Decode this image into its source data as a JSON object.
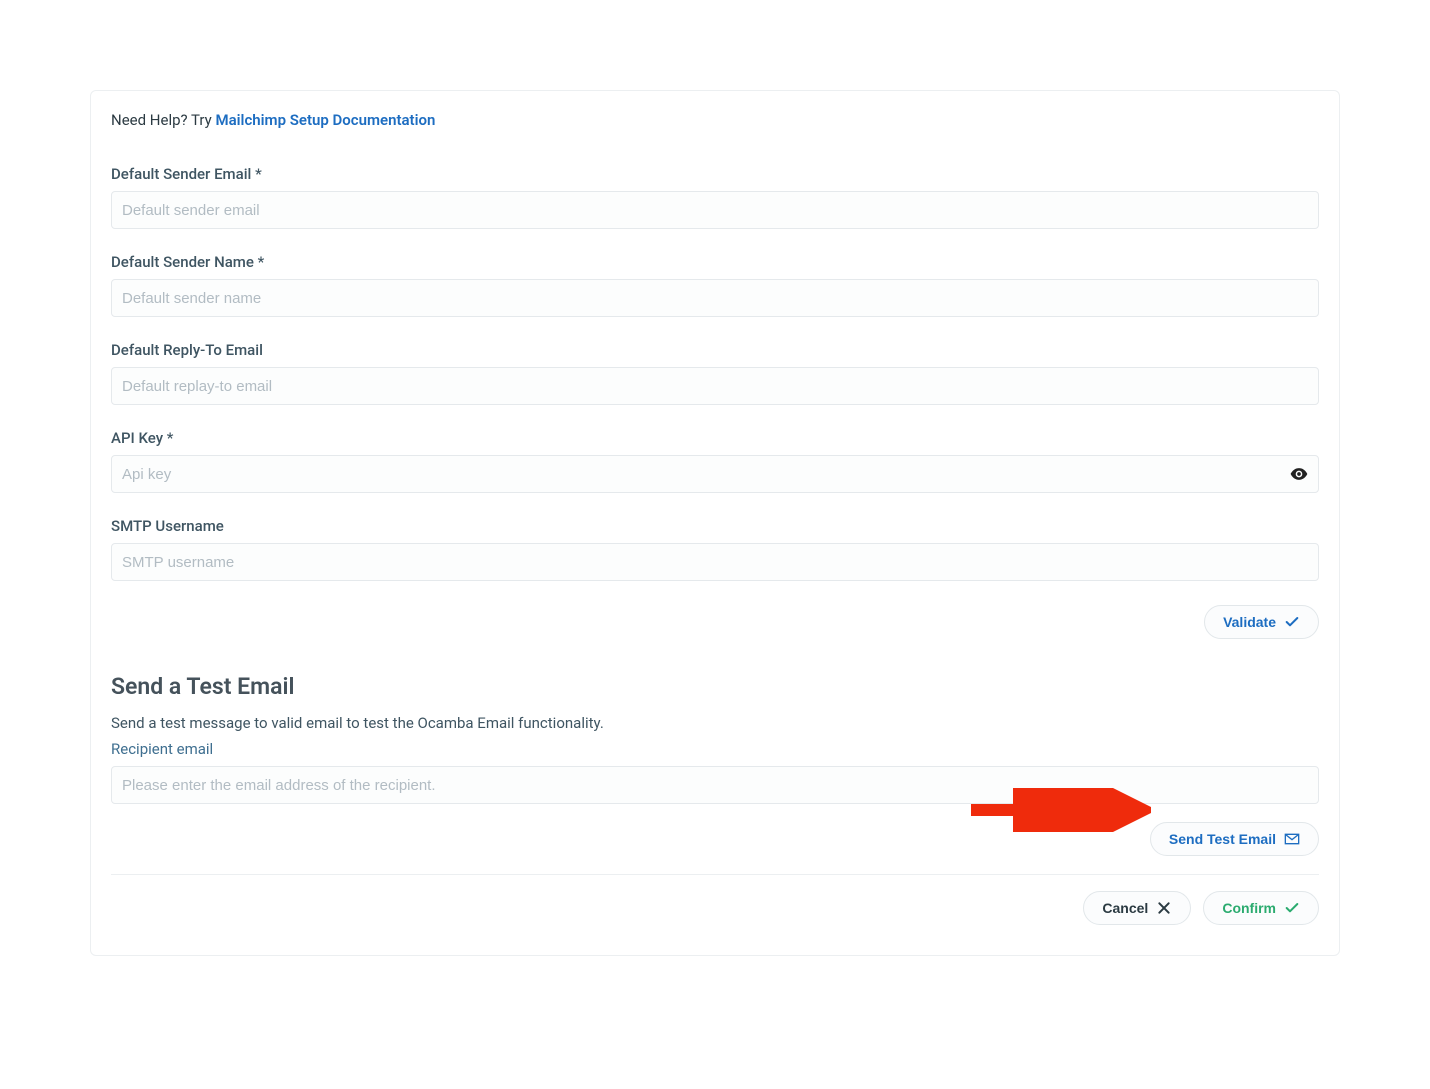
{
  "help": {
    "prefix": "Need Help? Try ",
    "link_text": "Mailchimp Setup Documentation"
  },
  "fields": {
    "sender_email": {
      "label": "Default Sender Email *",
      "placeholder": "Default sender email"
    },
    "sender_name": {
      "label": "Default Sender Name *",
      "placeholder": "Default sender name"
    },
    "reply_to": {
      "label": "Default Reply-To Email",
      "placeholder": "Default replay-to email"
    },
    "api_key": {
      "label": "API Key *",
      "placeholder": "Api key"
    },
    "smtp_user": {
      "label": "SMTP Username",
      "placeholder": "SMTP username"
    }
  },
  "buttons": {
    "validate": "Validate",
    "send_test": "Send Test Email",
    "cancel": "Cancel",
    "confirm": "Confirm"
  },
  "test_section": {
    "title": "Send a Test Email",
    "desc": "Send a test message to valid email to test the Ocamba Email functionality.",
    "recipient_label": "Recipient email",
    "recipient_placeholder": "Please enter the email address of the recipient."
  }
}
